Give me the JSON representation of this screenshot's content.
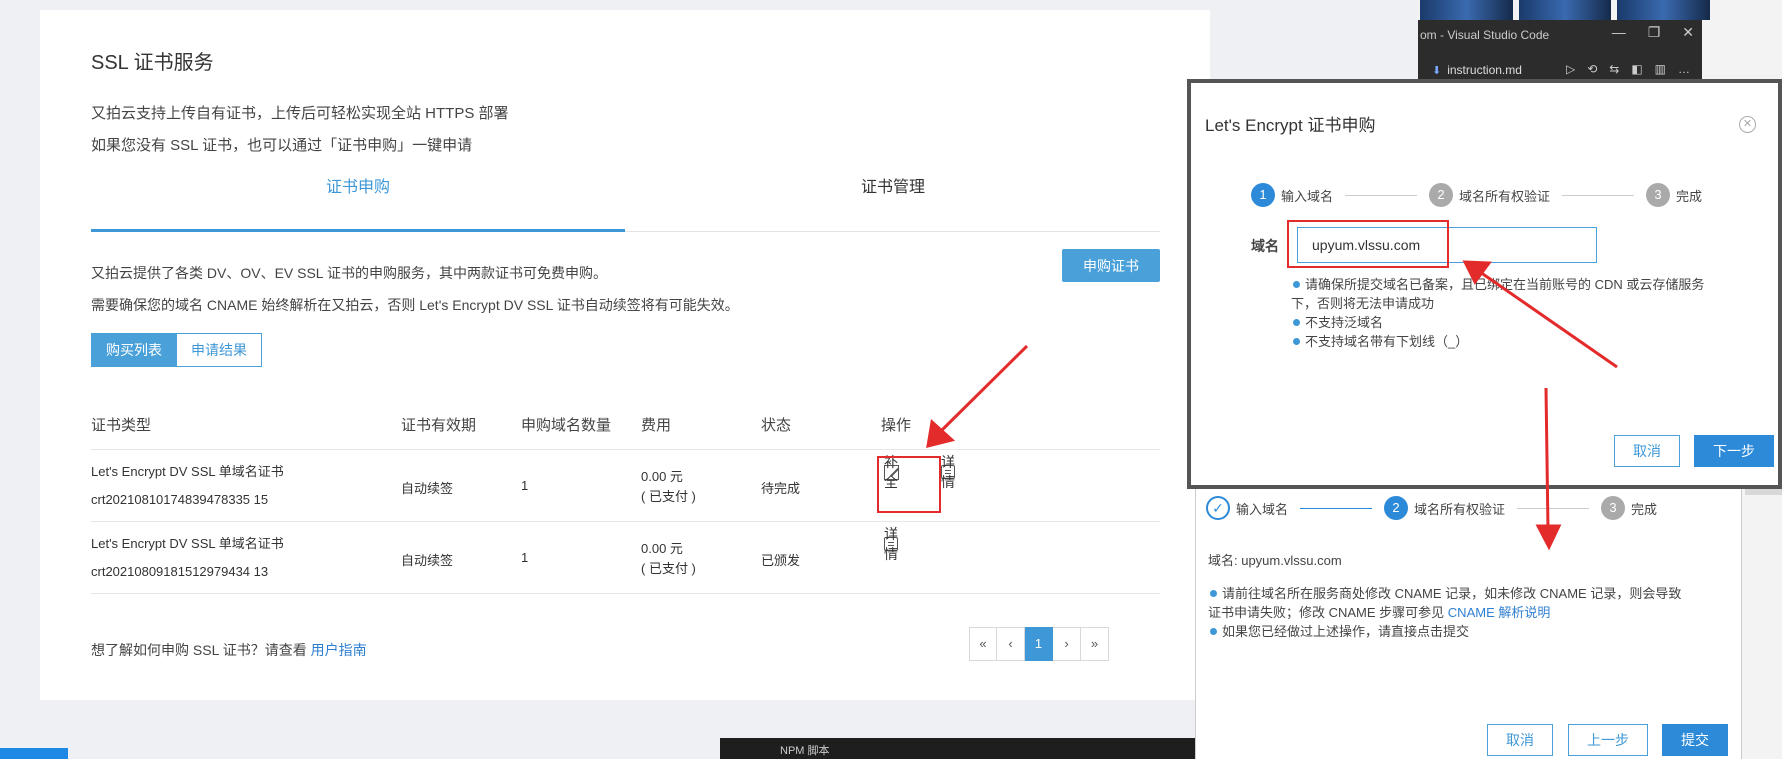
{
  "vscode": {
    "title": "om - Visual Studio Code",
    "tab_label": "instruction.md",
    "controls": [
      "—",
      "❐",
      "✕"
    ],
    "tools": [
      "▷",
      "⟲",
      "⇆",
      "◧",
      "▥",
      "…"
    ]
  },
  "taskbar": {
    "npm_label": "NPM 脚本"
  },
  "main": {
    "title": "SSL 证书服务",
    "intro_line1": "又拍云支持上传自有证书，上传后可轻松实现全站 HTTPS 部署",
    "intro_line2": "如果您没有 SSL 证书，也可以通过「证书申购」一键申请",
    "tabs": [
      {
        "label": "证书申购"
      },
      {
        "label": "证书管理"
      }
    ],
    "notes_line1": "又拍云提供了各类 DV、OV、EV SSL 证书的申购服务，其中两款证书可免费申购。",
    "notes_line2": "需要确保您的域名 CNAME 始终解析在又拍云，否则 Let's Encrypt DV SSL 证书自动续签将有可能失效。",
    "apply_button": "申购证书",
    "subtabs": [
      {
        "label": "购买列表"
      },
      {
        "label": "申请结果"
      }
    ],
    "table": {
      "headers": [
        "证书类型",
        "证书有效期",
        "申购域名数量",
        "费用",
        "状态",
        "操作"
      ],
      "rows": [
        {
          "type": "Let's Encrypt DV SSL 单域名证书",
          "id": "crt20210810174839478335 15",
          "validity": "自动续签",
          "count": "1",
          "fee": "0.00 元",
          "paid": "( 已支付 )",
          "status": "待完成",
          "action_complete": "补全",
          "action_detail": "详情"
        },
        {
          "type": "Let's Encrypt DV SSL 单域名证书",
          "id": "crt20210809181512979434 13",
          "validity": "自动续签",
          "count": "1",
          "fee": "0.00 元",
          "paid": "( 已支付 )",
          "status": "已颁发",
          "action_detail": "详情"
        }
      ]
    },
    "guide_text": "想了解如何申购 SSL 证书？请查看",
    "guide_link": "用户指南",
    "pager": [
      "«",
      "‹",
      "1",
      "›",
      "»"
    ]
  },
  "dialog1": {
    "title": "Let's Encrypt 证书申购",
    "steps": [
      {
        "num": "1",
        "label": "输入域名"
      },
      {
        "num": "2",
        "label": "域名所有权验证"
      },
      {
        "num": "3",
        "label": "完成"
      }
    ],
    "domain_label": "域名",
    "domain_value": "upyum.vlssu.com",
    "tip1a": "请确保所提交域名已备案，且已绑定在当前账号的 CDN 或云存储服务",
    "tip1b": "下，否则将无法申请成功",
    "tip2": "不支持泛域名",
    "tip3": "不支持域名带有下划线（_）",
    "cancel": "取消",
    "next": "下一步"
  },
  "dialog2": {
    "steps": [
      {
        "label": "输入域名"
      },
      {
        "num": "2",
        "label": "域名所有权验证"
      },
      {
        "num": "3",
        "label": "完成"
      }
    ],
    "domain_line": "域名: upyum.vlssu.com",
    "tip1a": "请前往域名所在服务商处修改 CNAME 记录，如未修改 CNAME 记录，则会导致",
    "tip1b": "证书申请失败；修改 CNAME 步骤可参见",
    "tip1_link": "CNAME 解析说明",
    "tip2": "如果您已经做过上述操作，请直接点击提交",
    "cancel": "取消",
    "prev": "上一步",
    "submit": "提交"
  },
  "colors": {
    "accent": "#3e97d6",
    "primary_button": "#2d8ad8",
    "annotation_red": "#e32b2b"
  }
}
